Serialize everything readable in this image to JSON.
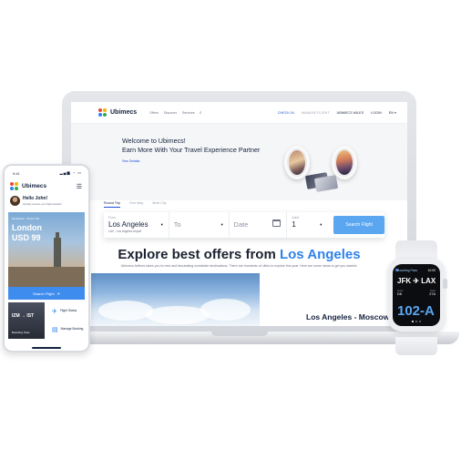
{
  "brand": {
    "name": "Ubimecs",
    "dot_colors": [
      "#e94b3c",
      "#f5b400",
      "#2f82e9",
      "#34a853"
    ]
  },
  "nav": {
    "links": [
      "Offers",
      "Discover",
      "Services"
    ],
    "search_icon": "search-icon",
    "right": [
      "CHECK-IN",
      "MANAGE FLIGHT",
      "UBIMECS MILES",
      "LOGIN",
      "EN ▾"
    ]
  },
  "hero": {
    "title": "Welcome to Ubimecs!",
    "subtitle": "Earn More With Your Travel Experience Partner",
    "link": "See Details",
    "arrow_icon": "chevron-right-icon"
  },
  "search": {
    "tabs": [
      "Round Trip",
      "One Way",
      "Multi City"
    ],
    "from_label": "From",
    "from_value": "Los Angeles",
    "from_sub": "LAX - Los Angeles Airport",
    "to_placeholder": "To",
    "date_placeholder": "Date",
    "adult_label": "Adult",
    "adult_value": "1",
    "button": "Search Flight"
  },
  "offers": {
    "title_prefix": "Explore best offers from",
    "title_city": "Los Angeles",
    "description": "Ubimecs Airlines takes you to new and fascinating worldwide destinations. There are hundreds of cities to explore this year. Here are some ideas to get you started.",
    "card_city": "Los Angeles - Moscow"
  },
  "phone": {
    "time": "9:41",
    "status": "▂▄▆ ◔ ▭",
    "greeting": "Hello John!",
    "greeting_sub": "Quickly access your flight details!",
    "card_label": "Destination - Round Trip",
    "card_city": "London",
    "card_price": "USD 99",
    "search_button": "Search Flight",
    "boarding_code": "IZM  →  IST",
    "boarding_label": "Boarding Pass",
    "tiles": [
      {
        "label": "Flight Status",
        "icon": "plane-icon"
      },
      {
        "label": "Manage Booking",
        "icon": "document-icon"
      }
    ]
  },
  "watch": {
    "app": "Boarding Pass",
    "time": "10:09",
    "route": "JFK ✈ LAX",
    "gate_label": "Gate",
    "gate": "D8",
    "seat_label": "Seat",
    "seat": "27A",
    "seat_code": "102-A"
  }
}
